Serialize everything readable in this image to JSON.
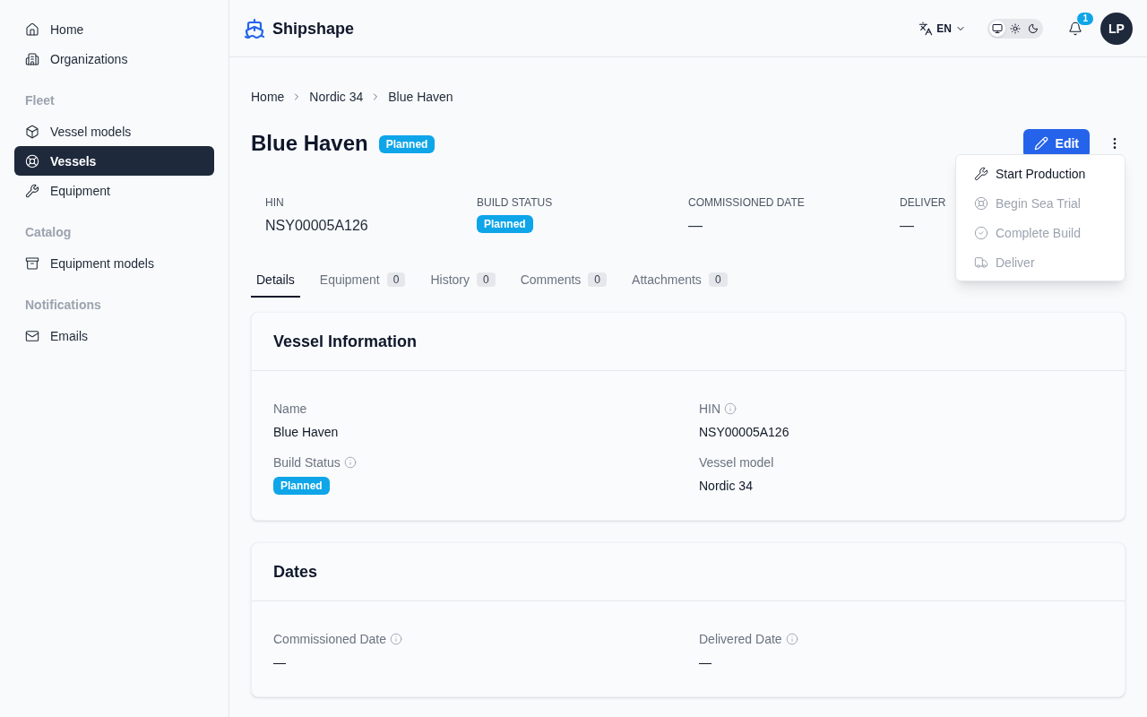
{
  "sidebar": {
    "sections": [
      {
        "items": [
          {
            "label": "Home",
            "selected": false
          },
          {
            "label": "Organizations",
            "selected": false
          }
        ]
      },
      {
        "heading": "Fleet",
        "items": [
          {
            "label": "Vessel models",
            "selected": false
          },
          {
            "label": "Vessels",
            "selected": true
          },
          {
            "label": "Equipment",
            "selected": false
          }
        ]
      },
      {
        "heading": "Catalog",
        "items": [
          {
            "label": "Equipment models",
            "selected": false
          }
        ]
      },
      {
        "heading": "Notifications",
        "items": [
          {
            "label": "Emails",
            "selected": false
          }
        ]
      }
    ]
  },
  "header": {
    "brand": "Shipshape",
    "language": "EN",
    "theme_options": [
      {
        "kind": "system",
        "selected": true
      },
      {
        "kind": "light",
        "selected": false
      },
      {
        "kind": "dark",
        "selected": false
      }
    ],
    "notification_count": "1",
    "avatar": "LP"
  },
  "breadcrumb": [
    "Home",
    "Nordic 34",
    "Blue Haven"
  ],
  "title": "Blue Haven",
  "title_badge": "Planned",
  "edit_button": "Edit",
  "actions_menu": [
    {
      "label": "Start Production",
      "disabled": false
    },
    {
      "label": "Begin Sea Trial",
      "disabled": true
    },
    {
      "label": "Complete Build",
      "disabled": true
    },
    {
      "label": "Deliver",
      "disabled": true
    }
  ],
  "summary": [
    {
      "label": "HIN",
      "value": "NSY00005A126",
      "kind": "text"
    },
    {
      "label": "BUILD STATUS",
      "value": "Planned",
      "kind": "badge"
    },
    {
      "label": "COMMISSIONED DATE",
      "value": "—",
      "kind": "text"
    },
    {
      "label": "DELIVER",
      "value": "—",
      "kind": "text"
    }
  ],
  "tabs": [
    {
      "label": "Details",
      "selected": true
    },
    {
      "label": "Equipment",
      "count": "0",
      "selected": false
    },
    {
      "label": "History",
      "count": "0",
      "selected": false
    },
    {
      "label": "Comments",
      "count": "0",
      "selected": false
    },
    {
      "label": "Attachments",
      "count": "0",
      "selected": false
    }
  ],
  "cards": [
    {
      "title": "Vessel Information",
      "fields": [
        {
          "label": "Name",
          "value": "Blue Haven",
          "info": false,
          "kind": "text"
        },
        {
          "label": "HIN",
          "value": "NSY00005A126",
          "info": true,
          "kind": "text"
        },
        {
          "label": "Build Status",
          "value": "Planned",
          "info": true,
          "kind": "badge"
        },
        {
          "label": "Vessel model",
          "value": "Nordic 34",
          "info": false,
          "kind": "text"
        }
      ]
    },
    {
      "title": "Dates",
      "fields": [
        {
          "label": "Commissioned Date",
          "value": "—",
          "info": true,
          "kind": "text"
        },
        {
          "label": "Delivered Date",
          "value": "—",
          "info": true,
          "kind": "text"
        }
      ]
    }
  ]
}
